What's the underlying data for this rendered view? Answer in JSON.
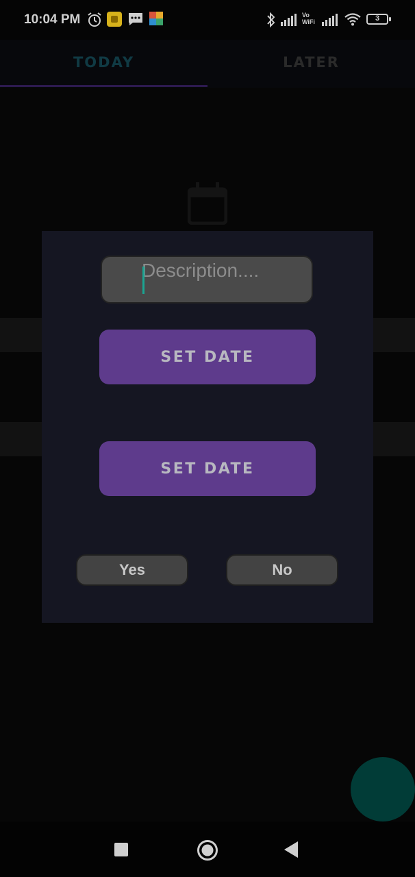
{
  "status_bar": {
    "time": "10:04 PM",
    "battery_level": "3",
    "icons": [
      "alarm-icon",
      "app-notification-icon",
      "message-icon",
      "app-icon",
      "bluetooth-icon",
      "signal-icon",
      "vowifi-icon",
      "signal-icon-2",
      "wifi-icon",
      "battery-icon"
    ],
    "vowifi_label_top": "Vo",
    "vowifi_label_bottom": "WiFi"
  },
  "tabs": [
    {
      "label": "TODAY",
      "selected": true
    },
    {
      "label": "LATER",
      "selected": false
    }
  ],
  "dialog": {
    "description_placeholder": "Description....",
    "description_value": "",
    "set_date_1_label": "SET DATE",
    "set_date_2_label": "SET DATE",
    "yes_label": "Yes",
    "no_label": "No"
  },
  "colors": {
    "accent_purple": "#5e3b8c",
    "caret_teal": "#1aa592",
    "fab_teal": "#013c37",
    "dialog_bg": "#151622"
  },
  "nav_bar": {
    "icons": [
      "recents-square-icon",
      "home-circle-icon",
      "back-triangle-icon"
    ]
  },
  "fab": {
    "icon": "fab-button"
  }
}
